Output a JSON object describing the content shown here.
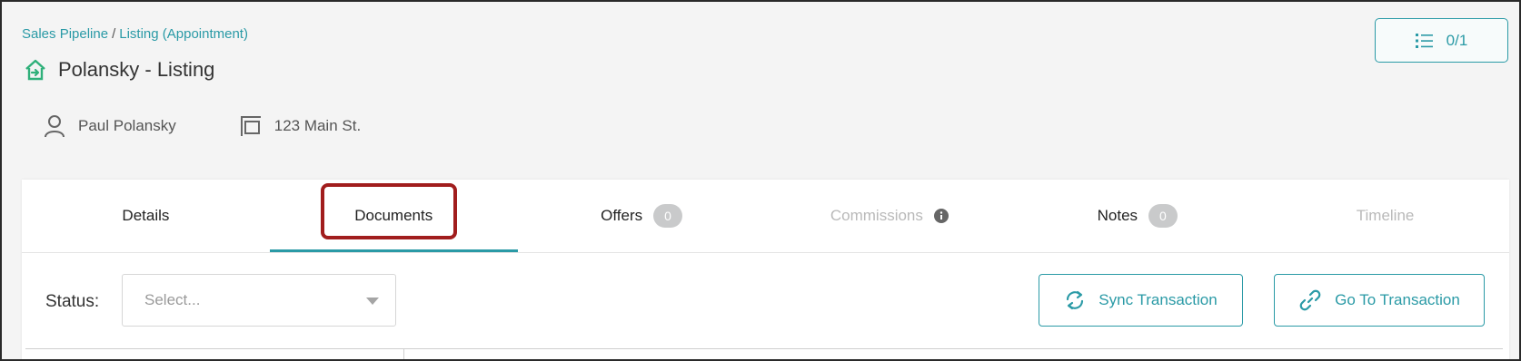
{
  "breadcrumb": {
    "items": [
      "Sales Pipeline",
      "Listing (Appointment)"
    ],
    "separator": "/"
  },
  "header": {
    "title": "Polansky - Listing",
    "icon": "house-arrow-icon",
    "counter_label": "0/1",
    "counter_icon": "list-icon"
  },
  "meta": {
    "contact_name": "Paul Polansky",
    "contact_icon": "person-icon",
    "address": "123 Main St.",
    "address_icon": "property-icon"
  },
  "tabs": [
    {
      "label": "Details"
    },
    {
      "label": "Documents",
      "active": true
    },
    {
      "label": "Offers",
      "badge": "0"
    },
    {
      "label": "Commissions",
      "disabled": true,
      "icon": "info-icon"
    },
    {
      "label": "Notes",
      "badge": "0"
    },
    {
      "label": "Timeline",
      "disabled": true
    }
  ],
  "filters": {
    "status_label": "Status:",
    "status_placeholder": "Select..."
  },
  "actions": {
    "sync_label": "Sync Transaction",
    "goto_label": "Go To Transaction"
  },
  "colors": {
    "accent": "#2a9aa6",
    "highlight": "#a11d1d",
    "badge": "#c9cacb",
    "background": "#f4f4f4"
  }
}
